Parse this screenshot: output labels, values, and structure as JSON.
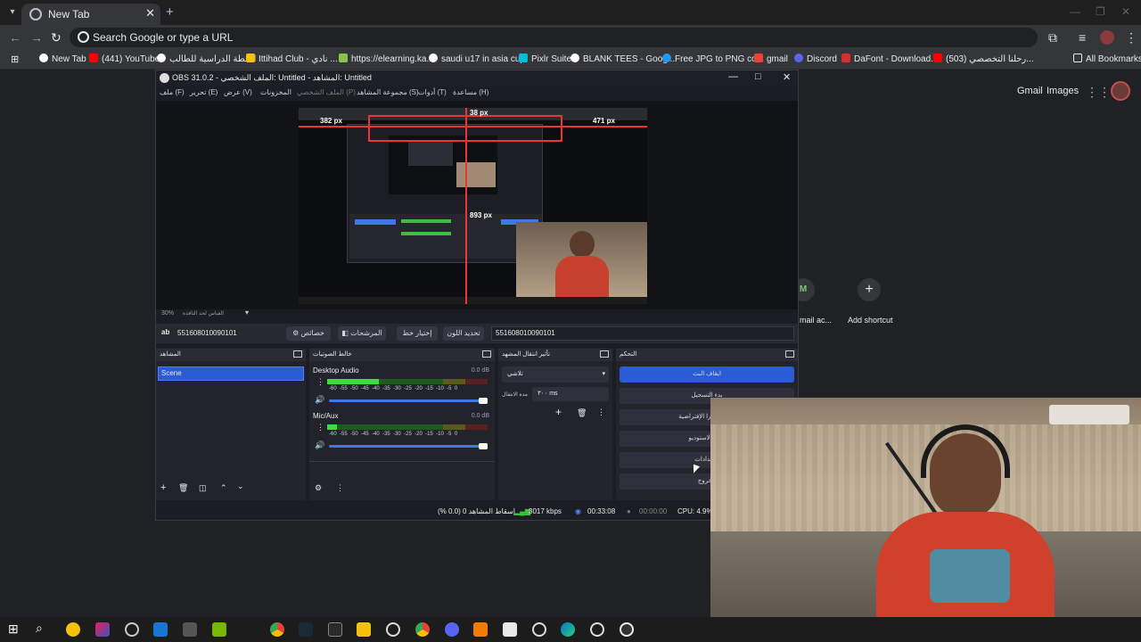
{
  "browser": {
    "tab_title": "New Tab",
    "omnibox_placeholder": "Search Google or type a URL",
    "bookmarks": [
      {
        "label": "New Tab",
        "color": "#ffffff"
      },
      {
        "label": "(441) YouTube",
        "color": "#ff0000"
      },
      {
        "label": "الخطة الدراسية للطالب",
        "color": "#ffffff"
      },
      {
        "label": "Ittihad Club - نادي ...",
        "color": "#f4c20d"
      },
      {
        "label": "https://elearning.ka...",
        "color": "#8bc34a"
      },
      {
        "label": "saudi u17 in asia cup",
        "color": "#ffffff"
      },
      {
        "label": "Pixlr Suite",
        "color": "#00bcd4"
      },
      {
        "label": "BLANK TEES - Goog...",
        "color": "#ffffff"
      },
      {
        "label": "Free JPG to PNG co...",
        "color": "#2196f3"
      },
      {
        "label": "gmail",
        "color": "#ea4335"
      },
      {
        "label": "Discord",
        "color": "#5865f2"
      },
      {
        "label": "DaFont - Download...",
        "color": "#d32f2f"
      },
      {
        "label": "(503) رحلنا التخصصي...",
        "color": "#ff0000"
      }
    ],
    "all_bookmarks": "All Bookmarks",
    "ntp": {
      "gmail": "Gmail",
      "images": "Images",
      "shortcuts": [
        {
          "label": "mail ac...",
          "initial": "M"
        },
        {
          "label": "Add shortcut",
          "initial": "+"
        }
      ]
    }
  },
  "obs": {
    "title": "OBS 31.0.2 - الملف الشخصي: Untitled - المشاهد: Untitled",
    "menu": [
      "ملف (F)",
      "تحرير (E)",
      "عرض (V)",
      "المخزونات",
      "الملف الشخصي (P)",
      "مجموعة المشاهد (S)",
      "أدوات (T)",
      "مساعدة (H)"
    ],
    "preview_measurements": {
      "top": "38 px",
      "left": "382 px",
      "right": "471 px",
      "bottom": "893 px"
    },
    "preview_zoom": "30%",
    "preview_scale_label": "القياس لحد النافذة",
    "context_source": "551608010090101",
    "context_buttons": {
      "properties": "خصائص",
      "filters": "المرشحات",
      "pick_line": "إختيار خط",
      "set_color": "تحديد اللون"
    },
    "context_text": "551608010090101",
    "scenes": {
      "header": "المشاهد",
      "items": [
        "Scene"
      ]
    },
    "mixer": {
      "header": "خالط الصوتيات",
      "tracks": [
        {
          "name": "Desktop Audio",
          "db": "0.0 dB",
          "level": 0.32
        },
        {
          "name": "Mic/Aux",
          "db": "0.0 dB",
          "level": 0.06
        }
      ],
      "ticks": [
        "-60",
        "-55",
        "-50",
        "-45",
        "-40",
        "-35",
        "-30",
        "-25",
        "-20",
        "-15",
        "-10",
        "-5",
        "0"
      ]
    },
    "transitions": {
      "header": "تأثير انتقال المشهد",
      "type": "تلاشي",
      "duration_label": "مدة الانتقال",
      "duration": "٣٠٠ ms"
    },
    "controls": {
      "header": "التحكم",
      "buttons": [
        "ايقاف البث",
        "بدء التسجيل",
        "بدء الكاميرا الإفتراضية",
        "وضع الاستوديو",
        "الإعدادات",
        "الخروج"
      ]
    },
    "status": {
      "dropped": "إسقاط المشاهد 0 (0.0 %)",
      "bitrate": "3017 kbps",
      "stream_time": "00:33:08",
      "rec_time": "00:00:00",
      "cpu": "CPU: 4.9%"
    }
  }
}
